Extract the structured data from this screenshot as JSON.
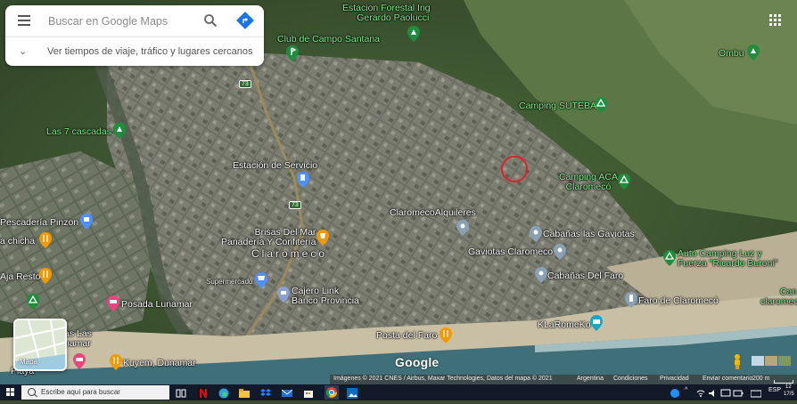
{
  "search": {
    "placeholder": "Buscar en Google Maps",
    "suggestion": "Ver tiempos de viaje, tráfico y lugares cercanos"
  },
  "map_labels": {
    "estacion_forestal": [
      "Estacion Forestal Ing",
      "Gerardo Paolucci"
    ],
    "club_campo": "Club de Campo Santana",
    "ombu": "Ombu",
    "camping_suteba": "Camping SUTEBA",
    "siete_cascadas": "Las 7 cascadas",
    "estacion_servicio": "Estación de Servicio",
    "camping_aca": [
      "Camping ACA",
      "Claromecó"
    ],
    "pescaderia": "Pescadería Pinzon",
    "chicha": "a chicha",
    "claromeco_alquileres": "ClaromecoAlquileres",
    "brisas": [
      "Brisas Del Mar",
      "Panadería Y Confitería"
    ],
    "cabanas_gaviotas": "Cabañas las Gaviotas",
    "claromeco_town": "Claromeco",
    "gaviotas_claromeco": "Gaviotas Claromeco",
    "auto_camping": [
      "Auto Camping Luz y",
      "Fuerza \"Ricardo Buroni\""
    ],
    "aja_resto": "Aja Resto",
    "supermercado": "Supermercado",
    "cajero": [
      "Cajero Link",
      "Banco Provincia"
    ],
    "cabanas_faro": "Cabañas Del Faro",
    "faro": "Faro de Claromecó",
    "posada": "Posada Lunamar",
    "claromeco_edge": [
      "Can",
      "claromec"
    ],
    "las_lunamar": [
      "as Las",
      "namar"
    ],
    "klaromeko": "KLaRomeKo",
    "posta": "Posta del Faro",
    "playa": [
      "Playa",
      "Duna"
    ],
    "kuyem": "Kuyem, Dunamar",
    "route_73_a": "73",
    "route_73_b": "73"
  },
  "controls": {
    "mapa_label": "Mapa",
    "google_logo": "Google"
  },
  "attribution": {
    "imagery": "Imágenes © 2021 CNES / Airbus, Maxar Technologies, Datos del mapa © 2021",
    "country": "Argentina",
    "terms": "Condiciones",
    "privacy": "Privacidad",
    "feedback": "Enviar comentario",
    "scale": "200 m"
  },
  "taskbar": {
    "search_placeholder": "Escribe aquí para buscar",
    "lang": "ESP",
    "time": "12",
    "date": "17/5"
  },
  "colors": {
    "park_green": "#7df08a",
    "pin_green": "#1e8e3e",
    "pin_blue": "#4d90fe",
    "pin_orange": "#f29900",
    "pin_pink": "#e8457c",
    "marker_red": "#e0202a",
    "ocean": "#3f6f78"
  }
}
